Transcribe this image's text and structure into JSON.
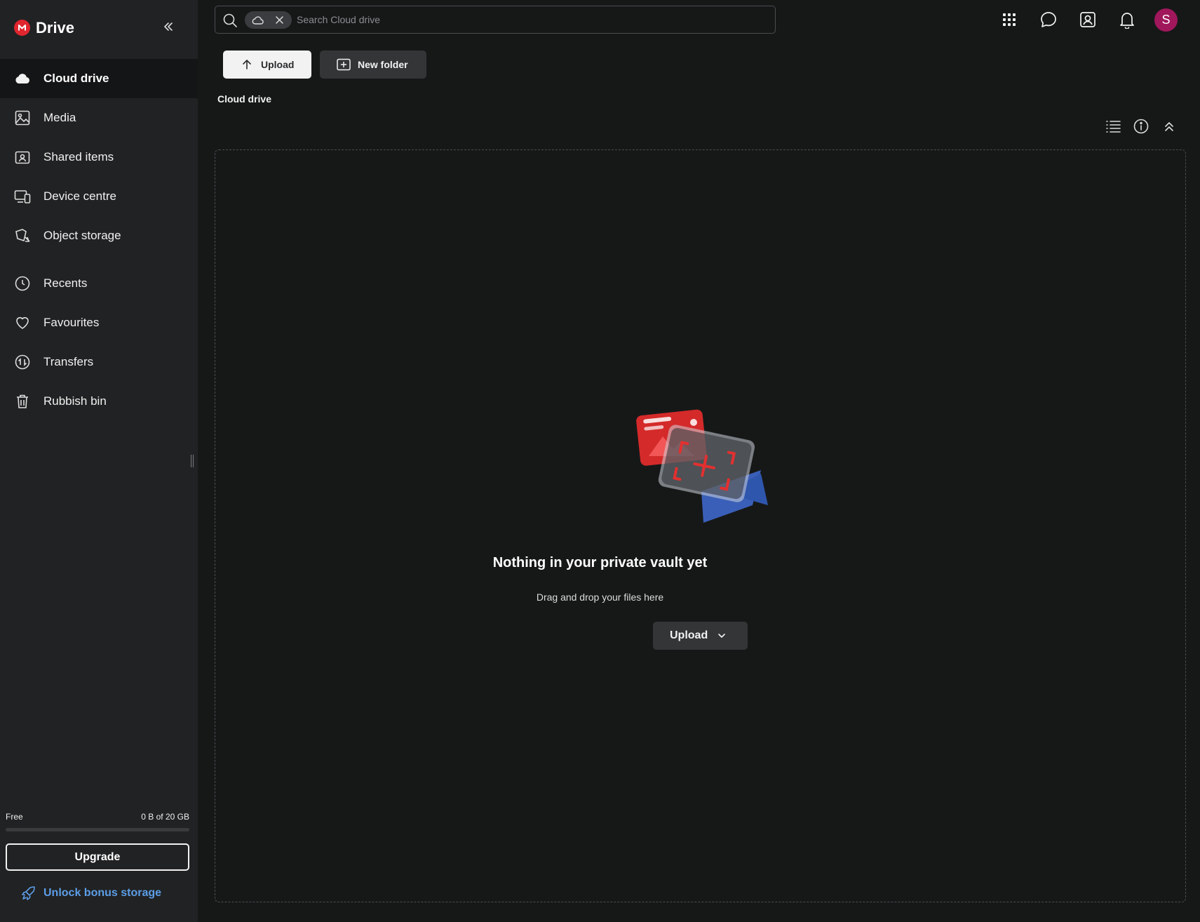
{
  "app": {
    "title": "Drive",
    "brand_color": "#e0262f"
  },
  "sidebar": {
    "collapse_icon": "chevrons-left-icon",
    "items": [
      {
        "label": "Cloud drive",
        "icon": "cloud-icon",
        "active": true
      },
      {
        "label": "Media",
        "icon": "image-icon"
      },
      {
        "label": "Shared items",
        "icon": "shared-folder-icon"
      },
      {
        "label": "Device centre",
        "icon": "devices-icon"
      },
      {
        "label": "Object storage",
        "icon": "bucket-icon"
      },
      {
        "label": "Recents",
        "icon": "clock-icon"
      },
      {
        "label": "Favourites",
        "icon": "heart-icon"
      },
      {
        "label": "Transfers",
        "icon": "transfer-icon"
      },
      {
        "label": "Rubbish bin",
        "icon": "trash-icon"
      }
    ],
    "storage": {
      "label": "Free",
      "usage": "0 B of 20 GB",
      "fill_fraction": 0
    },
    "upgrade_label": "Upgrade",
    "bonus_label": "Unlock bonus storage",
    "bonus_color": "#5c9ee8"
  },
  "header": {
    "search": {
      "placeholder": "Search Cloud drive",
      "value": "",
      "chip_icon": "cloud-icon"
    },
    "icons": [
      "apps-grid-icon",
      "chat-icon",
      "contacts-icon",
      "bell-icon"
    ],
    "avatar": {
      "initial": "S",
      "color": "#a0175c"
    }
  },
  "toolbar": {
    "upload_label": "Upload",
    "new_folder_label": "New folder"
  },
  "breadcrumb": "Cloud drive",
  "view_icons": [
    "list-view-icon",
    "info-icon",
    "collapse-up-icon"
  ],
  "empty_state": {
    "title": "Nothing in your private vault yet",
    "subtitle": "Drag and drop your files here",
    "upload_label": "Upload"
  }
}
